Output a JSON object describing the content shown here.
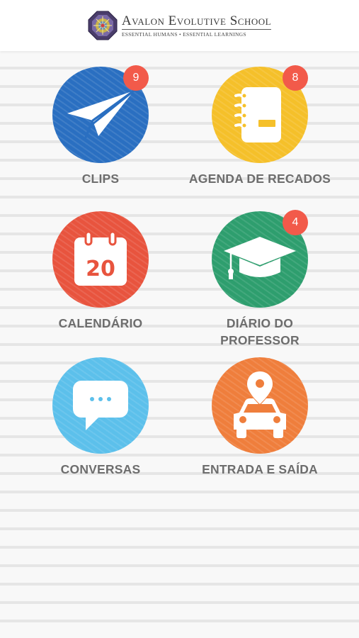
{
  "header": {
    "school_name": "Avalon Evolutive School",
    "tagline": "ESSENTIAL HUMANS • ESSENTIAL LEARNINGS"
  },
  "colors": {
    "clips": "#2a6fc1",
    "agenda": "#f5c02a",
    "calendario": "#e8543e",
    "diario": "#2e9e6e",
    "conversas": "#5cc0eb",
    "entrada": "#ef7e3c",
    "badge": "#f25a4a"
  },
  "tiles": [
    {
      "label": "CLIPS",
      "icon": "paper-plane-icon",
      "badge": "9"
    },
    {
      "label": "AGENDA DE RECADOS",
      "icon": "notebook-icon",
      "badge": "8"
    },
    {
      "label": "CALENDÁRIO",
      "icon": "calendar-icon",
      "day": "20"
    },
    {
      "label_lines": [
        "DIÁRIO DO",
        "PROFESSOR"
      ],
      "icon": "graduation-cap-icon",
      "badge": "4"
    },
    {
      "label": "CONVERSAS",
      "icon": "chat-bubble-icon"
    },
    {
      "label": "ENTRADA E SAÍDA",
      "icon": "car-location-icon"
    }
  ]
}
